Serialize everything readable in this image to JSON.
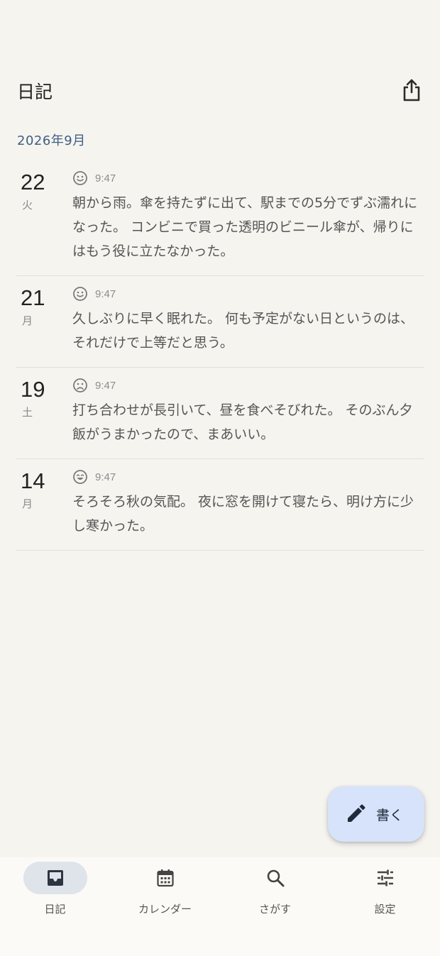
{
  "app": {
    "title": "日記"
  },
  "month": {
    "label": "2026年9月"
  },
  "entries": [
    {
      "day": "22",
      "weekday": "火",
      "mood": "smile-icon",
      "time": "9:47",
      "text": "朝から雨。傘を持たずに出て、駅までの5分でずぶ濡れになった。 コンビニで買った透明のビニール傘が、帰りにはもう役に立たなかった。"
    },
    {
      "day": "21",
      "weekday": "月",
      "mood": "smile-icon",
      "time": "9:47",
      "text": "久しぶりに早く眠れた。 何も予定がない日というのは、それだけで上等だと思う。"
    },
    {
      "day": "19",
      "weekday": "土",
      "mood": "sad-icon",
      "time": "9:47",
      "text": "打ち合わせが長引いて、昼を食べそびれた。 そのぶん夕飯がうまかったので、まあいい。"
    },
    {
      "day": "14",
      "weekday": "月",
      "mood": "grin-icon",
      "time": "9:47",
      "text": "そろそろ秋の気配。 夜に窓を開けて寝たら、明け方に少し寒かった。"
    }
  ],
  "fab": {
    "label": "書く"
  },
  "nav": {
    "items": [
      {
        "label": "日記",
        "icon": "inbox-icon",
        "active": true
      },
      {
        "label": "カレンダー",
        "icon": "calendar-icon",
        "active": false
      },
      {
        "label": "さがす",
        "icon": "search-icon",
        "active": false
      },
      {
        "label": "設定",
        "icon": "tune-icon",
        "active": false
      }
    ]
  },
  "colors": {
    "background": "#f6f4ef",
    "accent": "#3e5f85",
    "fab": "#d6e3fb",
    "nav_active": "#dfe3ea"
  }
}
